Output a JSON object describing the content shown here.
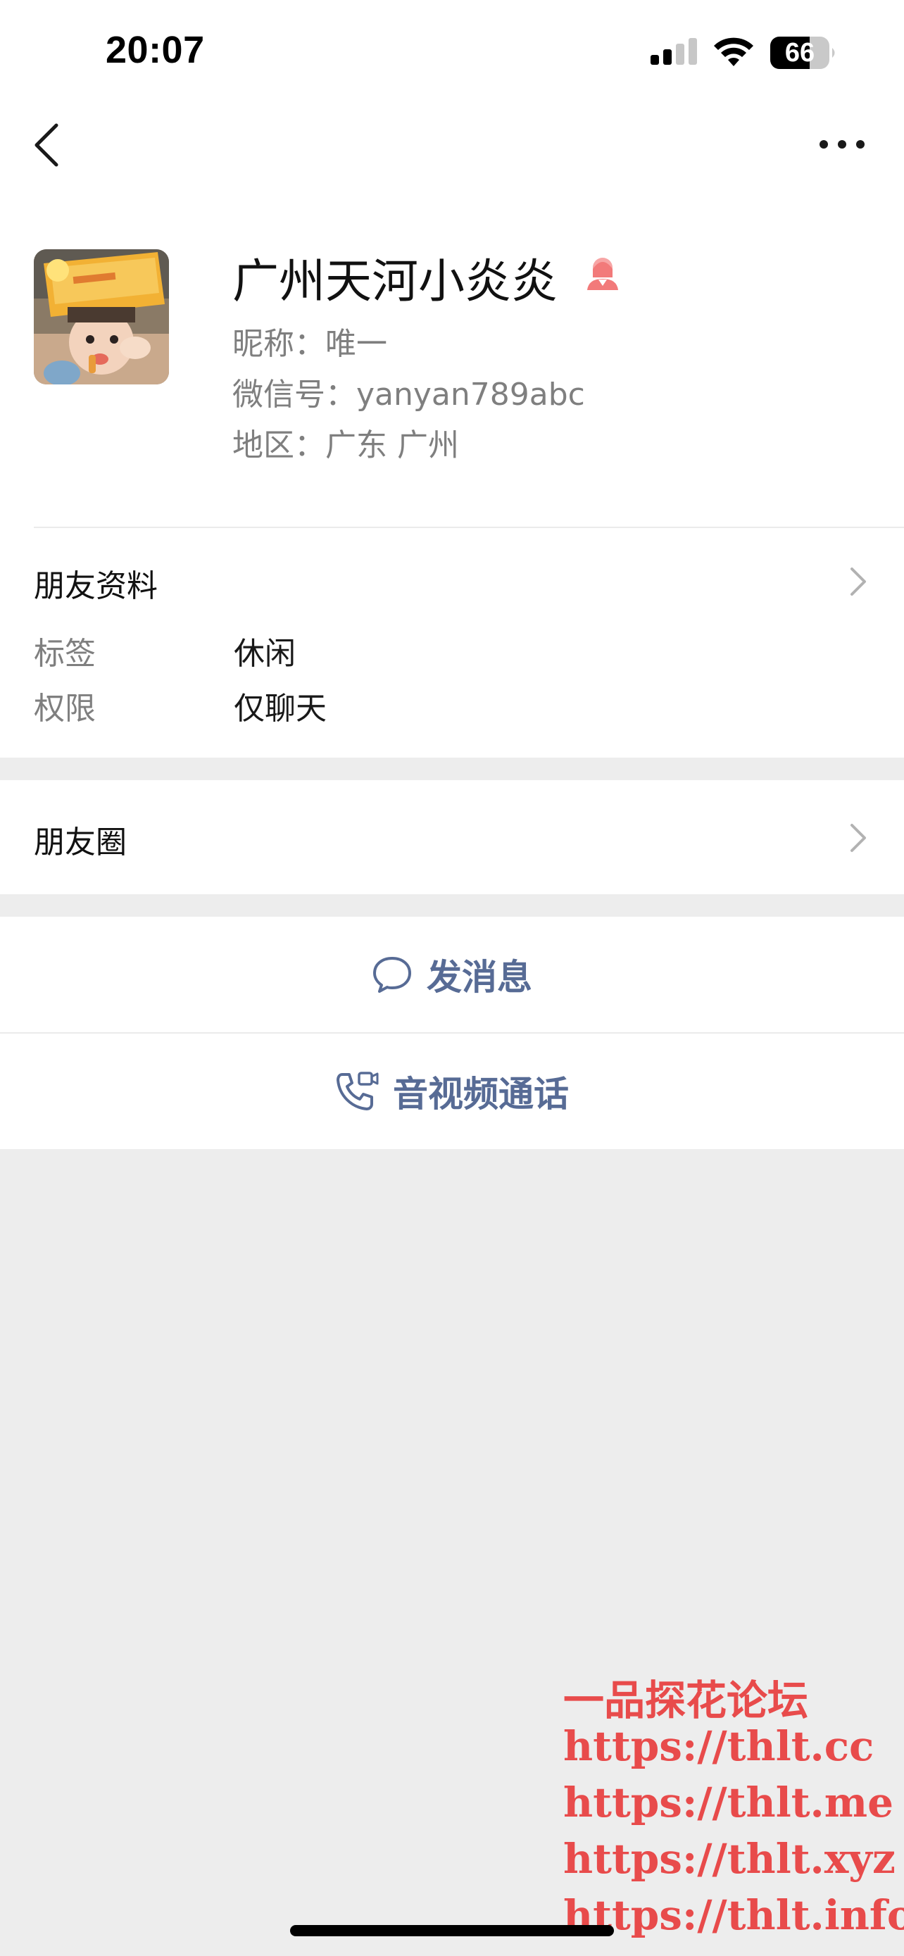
{
  "status_bar": {
    "time": "20:07",
    "battery_level": "66",
    "icons": [
      "signal-icon",
      "wifi-icon",
      "battery-icon"
    ]
  },
  "nav": {
    "back_icon": "chevron-left-icon",
    "more_icon": "more-dots-icon"
  },
  "profile": {
    "name": "广州天河小炎炎",
    "gender_icon": "female-icon",
    "gender_color": "#fa5151",
    "nickname": "昵称：唯一",
    "wechat_id": "微信号：yanyan789abc",
    "region": "地区：广东 广州"
  },
  "friend_info": {
    "title": "朋友资料",
    "rows": [
      {
        "label": "标签",
        "value": "休闲"
      },
      {
        "label": "权限",
        "value": "仅聊天"
      }
    ]
  },
  "moments": {
    "title": "朋友圈"
  },
  "actions": {
    "send_message": "发消息",
    "av_call": "音视频通话",
    "link_color": "#576b95"
  },
  "watermark": {
    "lines": [
      "一品探花论坛",
      "https://thlt.cc",
      "https://thlt.me",
      "https://thlt.xyz",
      "https://thlt.info"
    ],
    "color": "#e84b4b"
  }
}
